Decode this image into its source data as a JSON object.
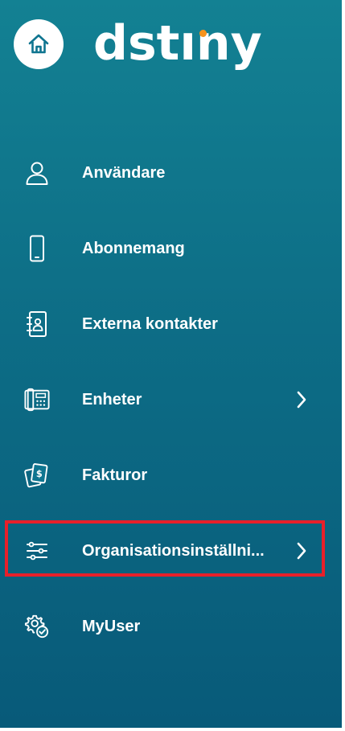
{
  "brand": {
    "logo_text_left": "dst",
    "logo_text_mid": "ı",
    "logo_text_right": "ny",
    "logo_accent_color": "#f7941d"
  },
  "header": {
    "home_icon": "home-icon"
  },
  "nav": {
    "items": [
      {
        "label": "Användare",
        "icon": "user-icon",
        "has_chevron": false
      },
      {
        "label": "Abonnemang",
        "icon": "mobile-phone-icon",
        "has_chevron": false
      },
      {
        "label": "Externa kontakter",
        "icon": "address-book-icon",
        "has_chevron": false
      },
      {
        "label": "Enheter",
        "icon": "desk-phone-icon",
        "has_chevron": true
      },
      {
        "label": "Fakturor",
        "icon": "invoice-icon",
        "has_chevron": false
      },
      {
        "label": "Organisationsinställni...",
        "icon": "settings-sliders-icon",
        "has_chevron": true,
        "highlighted": true
      },
      {
        "label": "MyUser",
        "icon": "user-gear-icon",
        "has_chevron": false
      }
    ]
  },
  "colors": {
    "sidebar_top": "#138193",
    "sidebar_bottom": "#085a79",
    "highlight": "#e8202a",
    "text": "#ffffff"
  }
}
